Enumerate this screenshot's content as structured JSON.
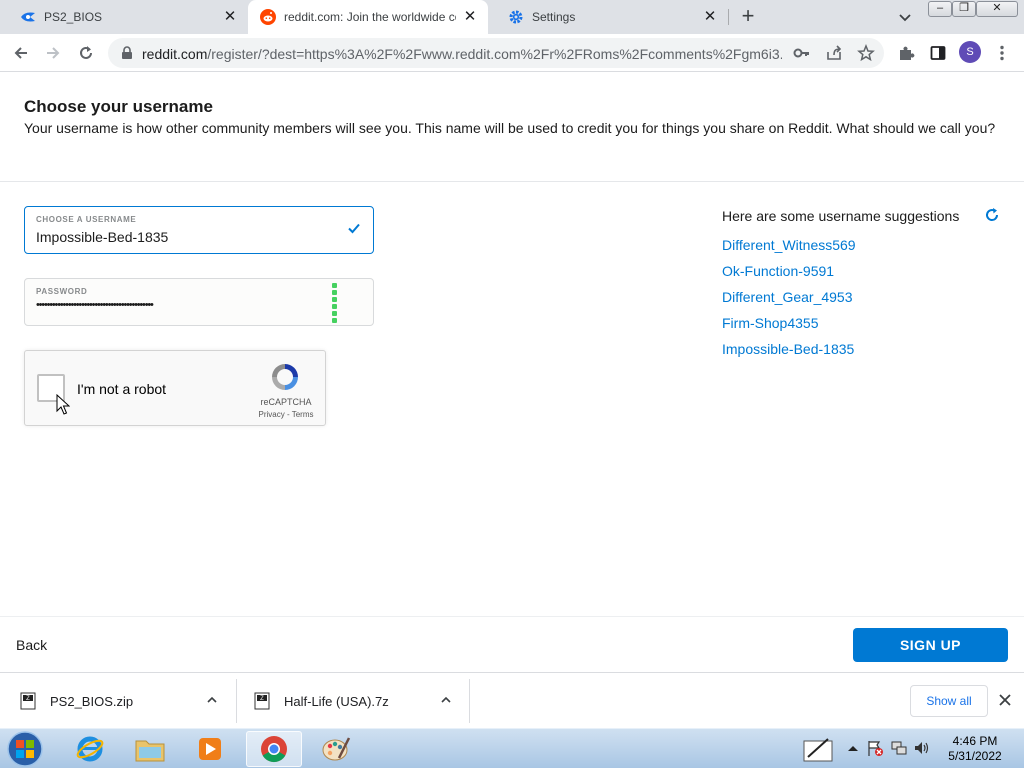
{
  "browser": {
    "tabs": [
      {
        "title": "PS2_BIOS",
        "active": false
      },
      {
        "title": "reddit.com: Join the worldwide conversation",
        "active": true
      },
      {
        "title": "Settings",
        "active": false
      }
    ],
    "url_host": "reddit.com",
    "url_path": "/register/?dest=https%3A%2F%2Fwww.reddit.com%2Fr%2FRoms%2Fcomments%2Fgm6i3...",
    "profile_initial": "S"
  },
  "page": {
    "title": "Choose your username",
    "description": "Your username is how other community members will see you. This name will be used to credit you for things you share on Reddit. What should we call you?",
    "username": {
      "label": "CHOOSE A USERNAME",
      "value": "Impossible-Bed-1835"
    },
    "password": {
      "label": "PASSWORD",
      "masked": "••••••••••••••••••••••••••••••••••••••••••••"
    },
    "recaptcha": {
      "label": "I'm not a robot",
      "brand": "reCAPTCHA",
      "privacy": "Privacy",
      "sep": " - ",
      "terms": "Terms"
    },
    "suggestions_title": "Here are some username suggestions",
    "suggestions": [
      "Different_Witness569",
      "Ok-Function-9591",
      "Different_Gear_4953",
      "Firm-Shop4355",
      "Impossible-Bed-1835"
    ],
    "back_label": "Back",
    "signup_label": "SIGN UP",
    "accent": "#0079d3"
  },
  "downloads": {
    "items": [
      {
        "name": "PS2_BIOS.zip"
      },
      {
        "name": "Half-Life (USA).7z"
      }
    ],
    "show_all": "Show all"
  },
  "taskbar": {
    "time": "4:46 PM",
    "date": "5/31/2022"
  }
}
